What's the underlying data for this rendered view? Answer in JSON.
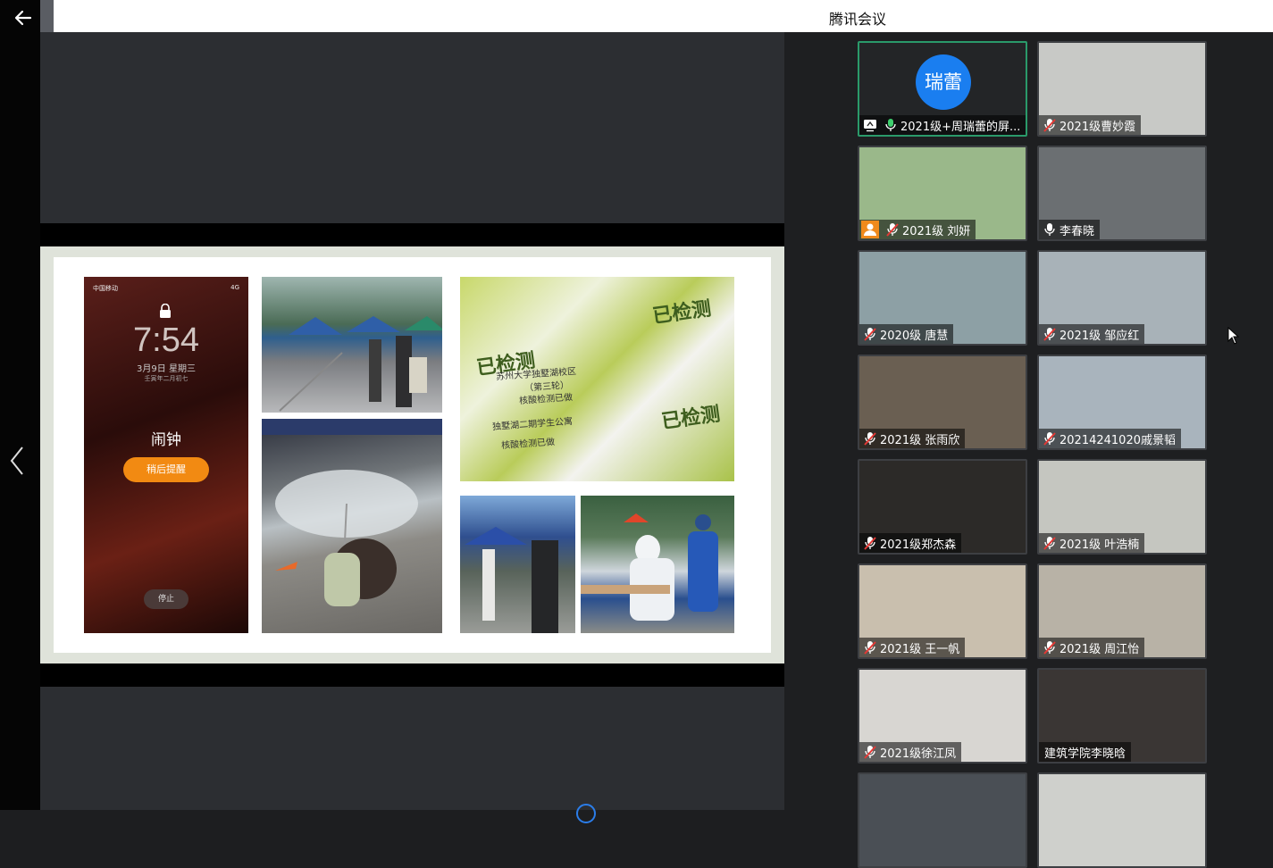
{
  "window": {
    "title": "腾讯会议"
  },
  "nav": {
    "back_icon": "arrow-left-icon",
    "prev_icon": "chevron-left-icon"
  },
  "slide": {
    "phone": {
      "carrier": "中国移动",
      "status": "4G",
      "time": "7:54",
      "date": "3月9日 星期三",
      "lunar": "壬寅年二月初七",
      "alarm_label": "闹钟",
      "snooze_label": "稍后提醒",
      "stop_label": "停止"
    },
    "cards": {
      "stamp_text": "已检测",
      "card_line1": "苏州大学独墅湖校区",
      "card_line2": "（第三轮）",
      "card_line3": "核酸检测已做",
      "card_line4": "独墅湖二期学生公寓",
      "card_line5": "核酸检测已做"
    }
  },
  "participants": [
    {
      "name": "2021级+周瑞蕾的屏...",
      "avatar_text": "瑞蕾",
      "icons": [
        "screen-share-icon",
        "mic-active-icon"
      ],
      "highlighted": true
    },
    {
      "name": "2021级曹妙霞",
      "icons": [
        "mic-muted-icon"
      ],
      "bg": "#c8c9c6"
    },
    {
      "name": "2021级 刘妍",
      "icons": [
        "user-box-icon",
        "mic-muted-icon"
      ],
      "bg": "#9ab88a"
    },
    {
      "name": "李春晓",
      "icons": [
        "mic-icon"
      ],
      "bg": "#6b6f72"
    },
    {
      "name": "2020级 唐慧",
      "icons": [
        "mic-muted-icon"
      ],
      "bg": "#8da0a5"
    },
    {
      "name": "2021级 邹应红",
      "icons": [
        "mic-muted-icon"
      ],
      "bg": "#a8b2b8"
    },
    {
      "name": "2021级 张雨欣",
      "icons": [
        "mic-muted-icon"
      ],
      "bg": "#6a5f52"
    },
    {
      "name": "20214241020戚景韬",
      "icons": [
        "mic-muted-icon"
      ],
      "bg": "#a9b4bd"
    },
    {
      "name": "2021级郑杰森",
      "icons": [
        "mic-muted-icon"
      ],
      "bg": "#2c2a28"
    },
    {
      "name": "2021级 叶浩楠",
      "icons": [
        "mic-muted-icon"
      ],
      "bg": "#c5c6c0"
    },
    {
      "name": "2021级 王一帆",
      "icons": [
        "mic-muted-icon"
      ],
      "bg": "#c9bfae"
    },
    {
      "name": "2021级 周江怡",
      "icons": [
        "mic-muted-icon"
      ],
      "bg": "#b8b2a6"
    },
    {
      "name": "2021级徐江凤",
      "icons": [
        "mic-muted-icon"
      ],
      "bg": "#d8d6d2"
    },
    {
      "name": "建筑学院李晓晗",
      "icons": [],
      "bg": "#3a3634"
    },
    {
      "name": "",
      "icons": [],
      "bg": "#4a4f55"
    },
    {
      "name": "",
      "icons": [],
      "bg": "#cfd0cc"
    }
  ]
}
